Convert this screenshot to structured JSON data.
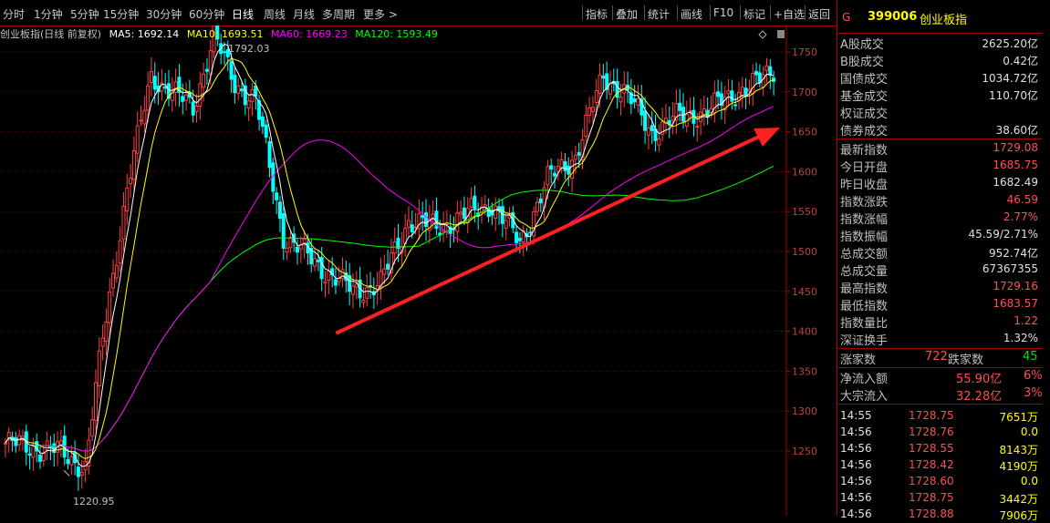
{
  "toolbar": {
    "periods": [
      "分时",
      "1分钟",
      "5分钟",
      "15分钟",
      "30分钟",
      "60分钟",
      "日线",
      "周线",
      "月线",
      "多周期",
      "更多 >"
    ],
    "active_period": "日线",
    "tools": [
      "指标",
      "叠加",
      "统计",
      "画线",
      "F10",
      "标记",
      "+自选",
      "返回"
    ]
  },
  "info": {
    "name": "创业板指(日线 前复权)",
    "ma5": "MA5: 1692.14",
    "ma10": "MA10: 1693.51",
    "ma60": "MA60: 1669.23",
    "ma120": "MA120: 1593.49",
    "high_label": "1792.03",
    "low_label": "1220.95"
  },
  "axis": {
    "ticks": [
      "1750",
      "1700",
      "1650",
      "1600",
      "1550",
      "1500",
      "1450",
      "1400",
      "1350",
      "1300",
      "1250"
    ]
  },
  "colors": {
    "up": "#ff4040",
    "down": "#00ffff",
    "ma5": "#ffffff",
    "ma10": "#ffff00",
    "ma60": "#ff00ff",
    "ma120": "#00ff00",
    "grid": "#8b0000",
    "arrow": "#ff2020"
  },
  "panel": {
    "marker": "G",
    "code": "399006",
    "name": "创业板指",
    "block1": [
      {
        "label": "A股成交",
        "value": "2625.20亿"
      },
      {
        "label": "B股成交",
        "value": "0.42亿"
      },
      {
        "label": "国债成交",
        "value": "1034.72亿"
      },
      {
        "label": "基金成交",
        "value": "110.70亿"
      },
      {
        "label": "权证成交",
        "value": ""
      },
      {
        "label": "债券成交",
        "value": "38.60亿"
      }
    ],
    "block2": [
      {
        "label": "最新指数",
        "value": "1729.08",
        "color": "red"
      },
      {
        "label": "今日开盘",
        "value": "1685.75",
        "color": "red"
      },
      {
        "label": "昨日收盘",
        "value": "1682.49",
        "color": "white"
      },
      {
        "label": "指数涨跌",
        "value": "46.59",
        "color": "red"
      },
      {
        "label": "指数涨幅",
        "value": "2.77%",
        "color": "red"
      },
      {
        "label": "指数振幅",
        "value": "45.59/2.71%",
        "color": "white"
      },
      {
        "label": "总成交额",
        "value": "952.74亿",
        "color": "white"
      },
      {
        "label": "总成交量",
        "value": "67367355",
        "color": "white"
      },
      {
        "label": "最高指数",
        "value": "1729.16",
        "color": "red"
      },
      {
        "label": "最低指数",
        "value": "1683.57",
        "color": "red"
      },
      {
        "label": "指数量比",
        "value": "1.22",
        "color": "red"
      },
      {
        "label": "深证换手",
        "value": "1.32%",
        "color": "white"
      }
    ],
    "updown": {
      "up_label": "涨家数",
      "up": "722",
      "down_label": "跌家数",
      "down": "45"
    },
    "flows": [
      {
        "label": "净流入额",
        "value": "55.90亿",
        "pct": "6%"
      },
      {
        "label": "大宗流入",
        "value": "32.28亿",
        "pct": "3%"
      }
    ],
    "ticks": [
      {
        "time": "14:55",
        "price": "1728.75",
        "vol": "7651万"
      },
      {
        "time": "14:56",
        "price": "1728.76",
        "vol": "0.0"
      },
      {
        "time": "14:56",
        "price": "1728.55",
        "vol": "8143万"
      },
      {
        "time": "14:56",
        "price": "1728.42",
        "vol": "4190万"
      },
      {
        "time": "14:56",
        "price": "1728.60",
        "vol": "0.0"
      },
      {
        "time": "14:56",
        "price": "1728.75",
        "vol": "3442万"
      },
      {
        "time": "14:56",
        "price": "1728.88",
        "vol": "7906万"
      }
    ]
  },
  "chart_data": {
    "type": "candlestick",
    "title": "创业板指(日线 前复权)",
    "ylim": [
      1220,
      1800
    ],
    "ma_lines": [
      "MA5",
      "MA10",
      "MA60",
      "MA120"
    ],
    "key_points": [
      {
        "x": 0,
        "close": 1260
      },
      {
        "x": 15,
        "close": 1250
      },
      {
        "x": 23,
        "close": 1230
      },
      {
        "x": 28,
        "close": 1390
      },
      {
        "x": 35,
        "close": 1580
      },
      {
        "x": 42,
        "close": 1720
      },
      {
        "x": 48,
        "close": 1700
      },
      {
        "x": 54,
        "close": 1680
      },
      {
        "x": 60,
        "close": 1770
      },
      {
        "x": 66,
        "close": 1710
      },
      {
        "x": 72,
        "close": 1690
      },
      {
        "x": 80,
        "close": 1520
      },
      {
        "x": 88,
        "close": 1490
      },
      {
        "x": 100,
        "close": 1450
      },
      {
        "x": 108,
        "close": 1460
      },
      {
        "x": 116,
        "close": 1540
      },
      {
        "x": 124,
        "close": 1530
      },
      {
        "x": 132,
        "close": 1545
      },
      {
        "x": 140,
        "close": 1560
      },
      {
        "x": 148,
        "close": 1510
      },
      {
        "x": 156,
        "close": 1590
      },
      {
        "x": 164,
        "close": 1620
      },
      {
        "x": 172,
        "close": 1720
      },
      {
        "x": 178,
        "close": 1700
      },
      {
        "x": 186,
        "close": 1650
      },
      {
        "x": 194,
        "close": 1670
      },
      {
        "x": 202,
        "close": 1675
      },
      {
        "x": 210,
        "close": 1700
      },
      {
        "x": 216,
        "close": 1710
      },
      {
        "x": 221,
        "close": 1729
      }
    ]
  }
}
